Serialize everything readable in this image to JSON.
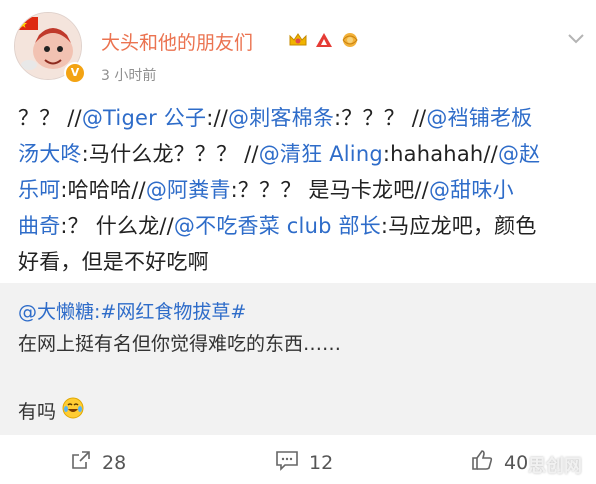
{
  "post": {
    "username": "大头和他的朋友们",
    "time": "3 小时前",
    "badges": [
      "crown-icon",
      "red-triangle-icon",
      "gold-flower-icon"
    ]
  },
  "content_lines": [
    [
      {
        "t": "？？ //",
        "m": false
      },
      {
        "t": "@Tiger 公子",
        "m": true
      },
      {
        "t": "://",
        "m": false
      },
      {
        "t": "@刺客棉条",
        "m": true
      },
      {
        "t": ":？？？ //",
        "m": false
      },
      {
        "t": "@裆铺老板",
        "m": true
      }
    ],
    [
      {
        "t": "汤大咚",
        "m": true
      },
      {
        "t": ":马什么龙？？？ //",
        "m": false
      },
      {
        "t": "@清狂 Aling",
        "m": true
      },
      {
        "t": ":hahahah//",
        "m": false
      },
      {
        "t": "@赵",
        "m": true
      }
    ],
    [
      {
        "t": "乐呵",
        "m": true
      },
      {
        "t": ":哈哈哈//",
        "m": false
      },
      {
        "t": "@阿粪青",
        "m": true
      },
      {
        "t": ":？？？ 是马卡龙吧//",
        "m": false
      },
      {
        "t": "@甜味小",
        "m": true
      }
    ],
    [
      {
        "t": "曲奇",
        "m": true
      },
      {
        "t": ":？ 什么龙//",
        "m": false
      },
      {
        "t": "@不吃香菜 club 部长",
        "m": true
      },
      {
        "t": ":马应龙吧，颜色",
        "m": false
      }
    ],
    [
      {
        "t": "好看，但是不好吃啊",
        "m": false
      }
    ]
  ],
  "repost": {
    "line1": "@大懒糖:#网红食物拔草#",
    "line2": "在网上挺有名但你觉得难吃的东西……",
    "line3": "有吗",
    "emoji": "crying-laughing-emoji"
  },
  "actions": {
    "repost_count": "28",
    "comment_count": "12",
    "like_count": "40"
  },
  "watermark": "思创网",
  "colors": {
    "link": "#2e6cc9",
    "username": "#eb7350",
    "repost_bg": "#f2f2f2"
  }
}
